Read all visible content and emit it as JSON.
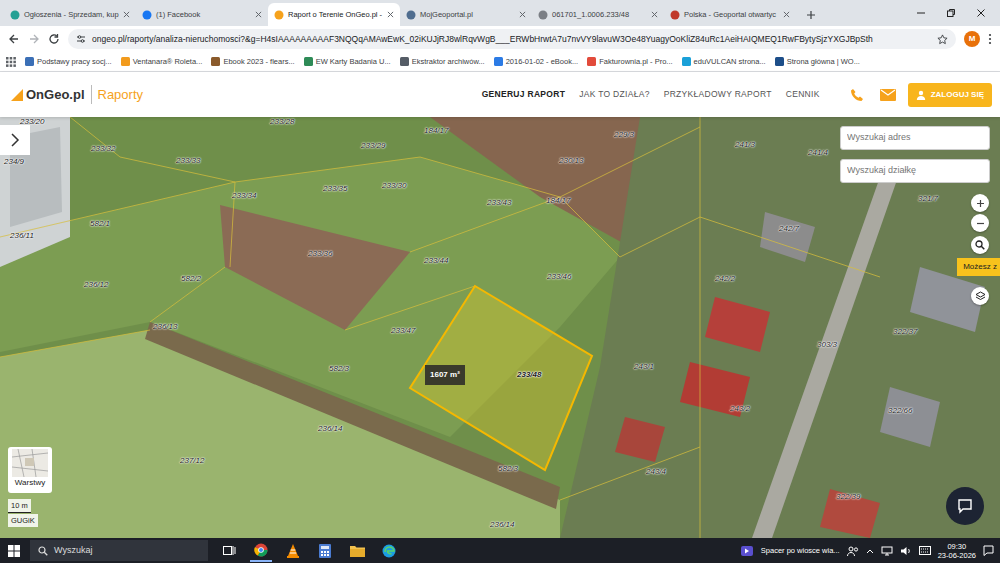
{
  "tabs": [
    {
      "label": "Ogłoszenia - Sprzedam, kup",
      "selected": false
    },
    {
      "label": "(1) Facebook",
      "selected": false
    },
    {
      "label": "Raport o Terenie OnGeo.pl -",
      "selected": true
    },
    {
      "label": "MojGeoportal.pl",
      "selected": false
    },
    {
      "label": "061701_1.0006.233/48",
      "selected": false
    },
    {
      "label": "Polska - Geoportal otwartyc",
      "selected": false
    }
  ],
  "address_bar": {
    "url": "ongeo.pl/raporty/analiza-nieruchomosci?&g=H4sIAAAAAAAAAF3NQQqAMAwEwK_02iKUJjRJ8wlRqvWgB___ERWbHrwtA7u7nvVY9lavuW3Oe48YuagyOoKliZ84uRc1AeiHAIQMEQ1RwFBytySjzYXGJBpSth",
    "profile": "M"
  },
  "bookmarks": [
    "Podstawy pracy socj...",
    "Ventanara® Roleta...",
    "Ebook 2023 - flears...",
    "EW Karty Badania U...",
    "Ekstraktor archiwów...",
    "2016-01-02 - eBook...",
    "Fakturownia.pl - Pro...",
    "eduVULCAN strona...",
    "Strona główna | WO..."
  ],
  "site": {
    "logo_main": "OnGeo.pl",
    "logo_sub": "Raporty",
    "nav": [
      {
        "label": "GENERUJ RAPORT",
        "selected": true
      },
      {
        "label": "JAK TO DZIAŁA?",
        "selected": false
      },
      {
        "label": "PRZYKŁADOWY RAPORT",
        "selected": false
      },
      {
        "label": "CENNIK",
        "selected": false
      }
    ],
    "login": "ZALOGUJ SIĘ"
  },
  "map": {
    "search_address": {
      "placeholder": "Wyszukaj adres"
    },
    "search_parcel": {
      "placeholder": "Wyszukaj działkę"
    },
    "hint": "Możesz z",
    "layers": "Warstwy",
    "scale": "10 m",
    "attribution": "GUGiK",
    "area": "1607 m²",
    "parcels": [
      {
        "label": "233/20",
        "selected": false
      },
      {
        "label": "233/28",
        "selected": false
      },
      {
        "label": "184/17",
        "selected": false
      },
      {
        "label": "229/3",
        "selected": false
      },
      {
        "label": "241/3",
        "selected": false
      },
      {
        "label": "241/4",
        "selected": false
      },
      {
        "label": "233/32",
        "selected": false
      },
      {
        "label": "233/29",
        "selected": false
      },
      {
        "label": "230/13",
        "selected": false
      },
      {
        "label": "234/9",
        "selected": false
      },
      {
        "label": "233/33",
        "selected": false
      },
      {
        "label": "233/35",
        "selected": false
      },
      {
        "label": "233/30",
        "selected": false
      },
      {
        "label": "184/17",
        "selected": false
      },
      {
        "label": "321/7",
        "selected": false
      },
      {
        "label": "233/34",
        "selected": false
      },
      {
        "label": "582/1",
        "selected": false
      },
      {
        "label": "233/43",
        "selected": false
      },
      {
        "label": "242/7",
        "selected": false
      },
      {
        "label": "236/11",
        "selected": false
      },
      {
        "label": "233/36",
        "selected": false
      },
      {
        "label": "233/44",
        "selected": false
      },
      {
        "label": "242/2",
        "selected": false
      },
      {
        "label": "236/12",
        "selected": false
      },
      {
        "label": "582/2",
        "selected": false
      },
      {
        "label": "233/46",
        "selected": false
      },
      {
        "label": "236/13",
        "selected": false
      },
      {
        "label": "322/37",
        "selected": false
      },
      {
        "label": "233/47",
        "selected": false
      },
      {
        "label": "303/3",
        "selected": false
      },
      {
        "label": "243/1",
        "selected": false
      },
      {
        "label": "582/3",
        "selected": false
      },
      {
        "label": "233/48",
        "selected": true
      },
      {
        "label": "243/2",
        "selected": false
      },
      {
        "label": "322/66",
        "selected": false
      },
      {
        "label": "236/14",
        "selected": false
      },
      {
        "label": "237/12",
        "selected": false
      },
      {
        "label": "243/4",
        "selected": false
      },
      {
        "label": "582/3",
        "selected": false
      },
      {
        "label": "322/39",
        "selected": false
      },
      {
        "label": "236/14",
        "selected": false
      }
    ]
  },
  "taskbar": {
    "search": "Wyszukaj",
    "weather": "Spacer po wiosce wia...",
    "time": "09:30",
    "date": "23-06-2026"
  }
}
